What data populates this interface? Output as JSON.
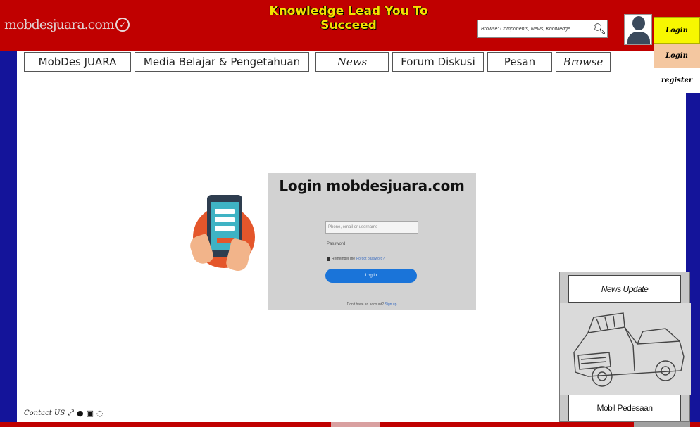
{
  "header": {
    "logo_text": "mobdesjuara.com",
    "tagline": "Knowledge Lead You To Succeed",
    "search_placeholder": "Browse: Components, News, Knowledge",
    "login_button": "Login"
  },
  "nav": {
    "items": [
      "MobDes JUARA",
      "Media Belajar & Pengetahuan",
      "News",
      "Forum Diskusi",
      "Pesan",
      "Browse"
    ]
  },
  "account_menu": {
    "login": "Login",
    "register": "register"
  },
  "login_form": {
    "title": "Login mobdesjuara.com",
    "username_placeholder": "Phone, email or username",
    "password_label": "Password",
    "remember_label": "Remember me",
    "forgot_label": "Forgot password?",
    "submit_label": "Log in",
    "signup_prompt": "Don't have an account?",
    "signup_link": "Sign up"
  },
  "widget": {
    "header": "News Update",
    "caption": "Mobil Pedesaan"
  },
  "footer": {
    "contact_label": "Contact US"
  },
  "colors": {
    "header_red": "#c00000",
    "side_blue": "#14149a",
    "tagline_yellow": "#f5e000",
    "login_yellow": "#f7f700",
    "login_button_blue": "#1a74d9"
  }
}
